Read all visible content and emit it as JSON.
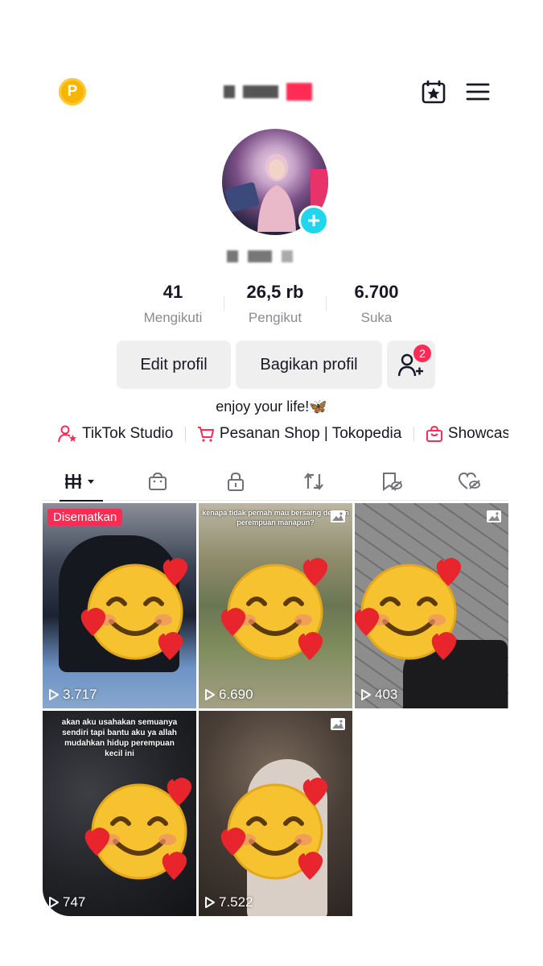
{
  "header": {
    "coin_letter": "P",
    "username_masked": true
  },
  "profile": {
    "bio": "enjoy your life!🦋"
  },
  "stats": [
    {
      "value": "41",
      "label": "Mengikuti"
    },
    {
      "value": "26,5 rb",
      "label": "Pengikut"
    },
    {
      "value": "6.700",
      "label": "Suka"
    }
  ],
  "buttons": {
    "edit": "Edit profil",
    "share": "Bagikan profil",
    "add_friends_badge": "2"
  },
  "links": [
    {
      "label": "TikTok Studio",
      "icon": "person-star-icon"
    },
    {
      "label": "Pesanan Shop | Tokopedia",
      "icon": "cart-icon"
    },
    {
      "label": "Showcas",
      "icon": "shopping-bag-icon"
    }
  ],
  "tabs": [
    {
      "icon": "videos-grid-icon"
    },
    {
      "icon": "shop-bag-icon"
    },
    {
      "icon": "lock-icon"
    },
    {
      "icon": "repost-icon"
    },
    {
      "icon": "favorites-hidden-icon"
    },
    {
      "icon": "liked-hidden-icon"
    }
  ],
  "videos": [
    {
      "views": "3.717",
      "pinned_label": "Disematkan",
      "type": "video"
    },
    {
      "views": "6.690",
      "caption": "kenapa tidak pernah mau bersaing dengan perempuan manapun?",
      "type": "photo"
    },
    {
      "views": "403",
      "type": "photo"
    },
    {
      "views": "747",
      "caption": "akan aku usahakan semuanya sendiri tapi bantu aku ya allah mudahkan hidup perempuan kecil ini",
      "type": "video"
    },
    {
      "views": "7.522",
      "type": "photo"
    }
  ],
  "colors": {
    "accent": "#fe2c55",
    "teal": "#20d5ec",
    "coin": "#f7b500"
  }
}
